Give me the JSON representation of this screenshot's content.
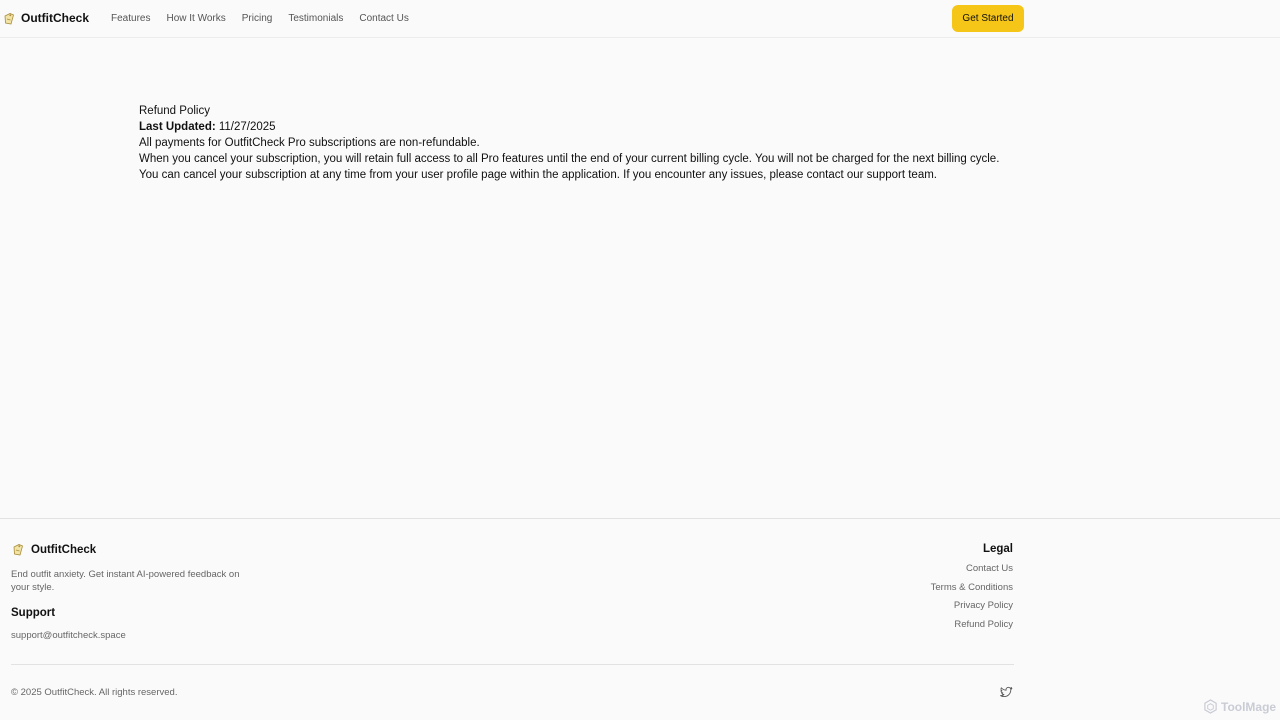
{
  "nav": {
    "brand": "OutfitCheck",
    "logo_icon": "hanger-tag-icon",
    "links": [
      "Features",
      "How It Works",
      "Pricing",
      "Testimonials",
      "Contact Us"
    ],
    "cta": "Get Started",
    "cta_color": "#f5c518"
  },
  "policy": {
    "title": "Refund Policy",
    "updated_label": "Last Updated:",
    "updated_value": " 11/27/2025",
    "paragraphs": [
      "All payments for OutfitCheck Pro subscriptions are non-refundable.",
      "When you cancel your subscription, you will retain full access to all Pro features until the end of your current billing cycle. You will not be charged for the next billing cycle.",
      "You can cancel your subscription at any time from your user profile page within the application. If you encounter any issues, please contact our support team."
    ]
  },
  "footer": {
    "brand": "OutfitCheck",
    "tagline": "End outfit anxiety. Get instant AI-powered feedback on your style.",
    "support_heading": "Support",
    "support_email": "support@outfitcheck.space",
    "legal_heading": "Legal",
    "legal_links": [
      "Contact Us",
      "Terms & Conditions",
      "Privacy Policy",
      "Refund Policy"
    ],
    "copyright": "© 2025 OutfitCheck. All rights reserved.",
    "social_icon": "twitter-icon"
  },
  "watermark": "ToolMage"
}
